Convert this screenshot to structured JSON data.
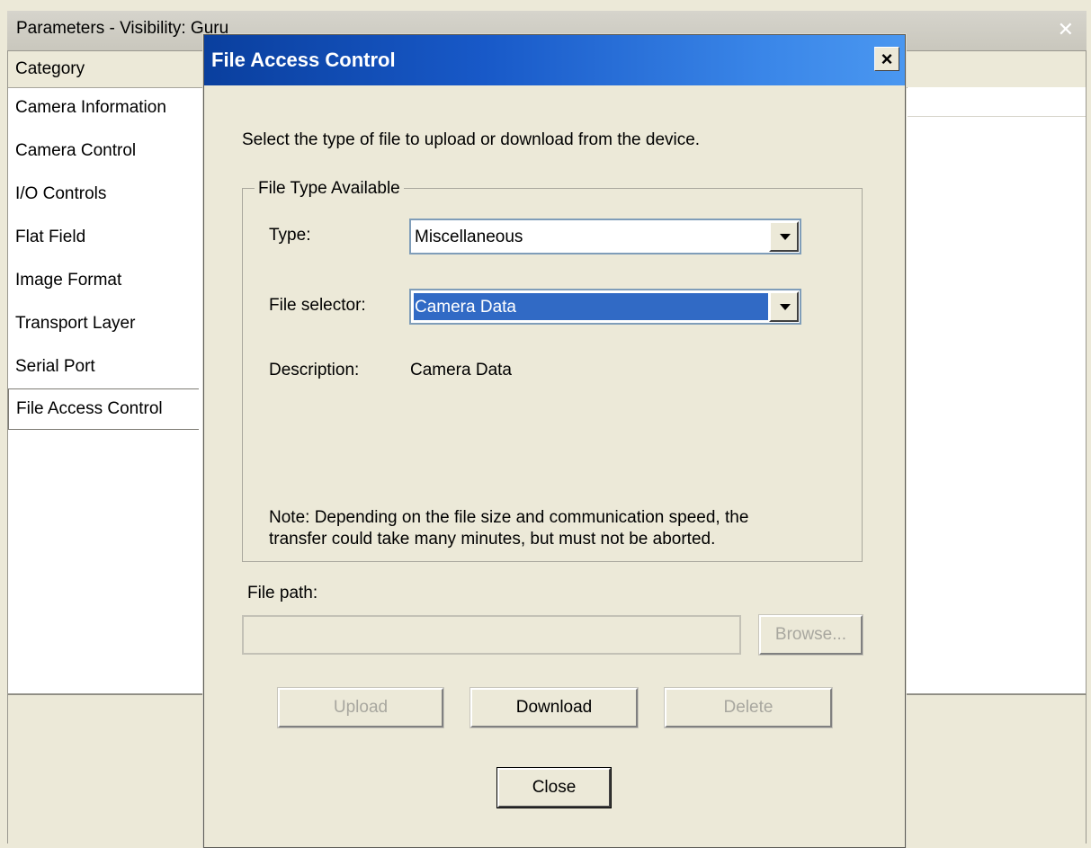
{
  "background_window": {
    "title": "Parameters - Visibility: Guru",
    "close_glyph": "✕",
    "category_header": "Category",
    "categories": [
      {
        "label": "Camera Information"
      },
      {
        "label": "Camera Control"
      },
      {
        "label": "I/O Controls"
      },
      {
        "label": "Flat Field"
      },
      {
        "label": "Image Format"
      },
      {
        "label": "Transport Layer"
      },
      {
        "label": "Serial Port"
      },
      {
        "label": "File Access Control",
        "selected": true
      }
    ]
  },
  "dialog": {
    "title": "File Access Control",
    "close_glyph": "×",
    "intro": "Select the type of file to upload or download from the device.",
    "group_title": "File Type Available",
    "type": {
      "label": "Type:",
      "value": "Miscellaneous"
    },
    "file_selector": {
      "label": "File selector:",
      "value": "Camera Data"
    },
    "description": {
      "label": "Description:",
      "value": "Camera Data"
    },
    "note_line1": "Note: Depending on the file size and communication speed, the",
    "note_line2": "transfer could take many minutes, but must not be aborted.",
    "file_path": {
      "label": "File path:",
      "value": "",
      "enabled": false
    },
    "buttons": {
      "browse": {
        "label": "Browse...",
        "enabled": false
      },
      "upload": {
        "label": "Upload",
        "enabled": false
      },
      "download": {
        "label": "Download",
        "enabled": true
      },
      "delete": {
        "label": "Delete",
        "enabled": false
      },
      "close": {
        "label": "Close",
        "enabled": true
      }
    }
  }
}
